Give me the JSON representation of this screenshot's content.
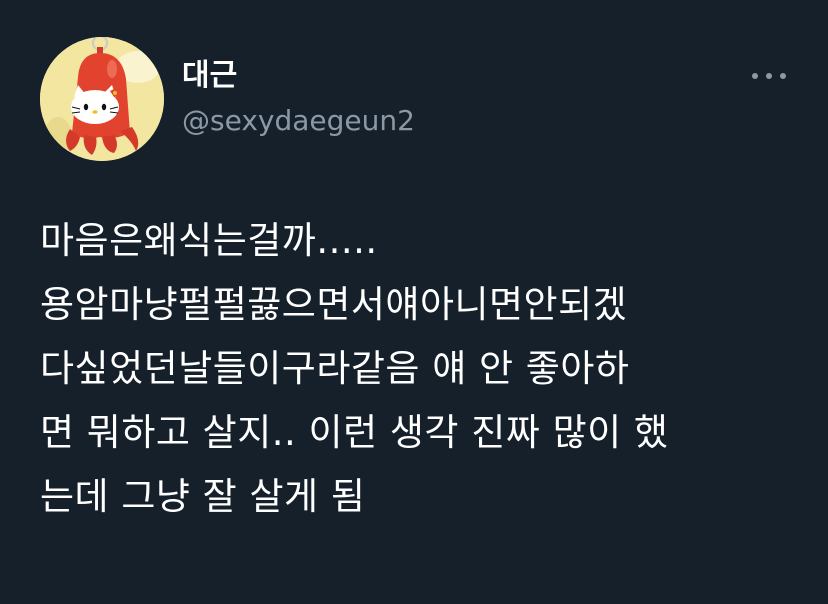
{
  "tweet": {
    "author": {
      "display_name": "대근",
      "handle": "@sexydaegeun2",
      "avatar_icon": "hello-kitty-octopus-avatar"
    },
    "more_icon": "more-dots-icon",
    "text_lines": [
      "마음은왜식는걸까.....",
      "용암마냥펄펄끓으면서얘아니면안되겠",
      "다싶었던날들이구라같음 얘 안 좋아하",
      "면 뭐하고 살지.. 이런 생각 진짜 많이 했",
      "는데 그냥 잘 살게 됨"
    ]
  },
  "colors": {
    "background": "#15202b",
    "primary_text": "#ffffff",
    "secondary_text": "#8b98a5"
  }
}
